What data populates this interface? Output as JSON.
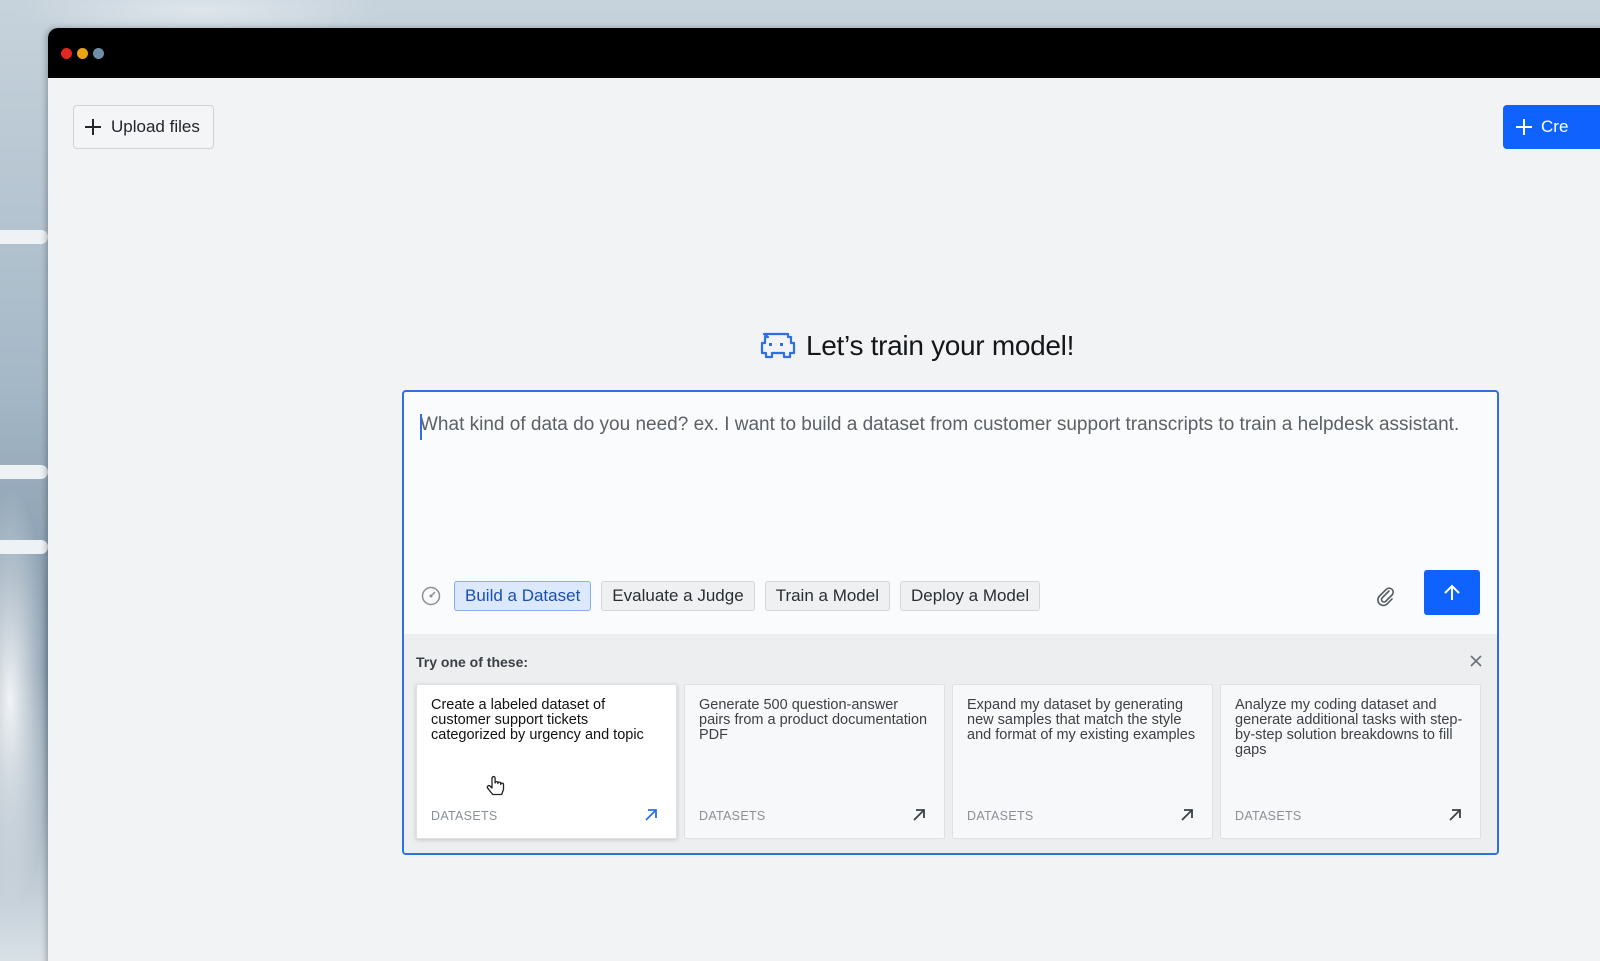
{
  "window": {
    "header": {
      "upload_label": "Upload files",
      "create_label": "Cre"
    },
    "heading": {
      "title": "Let’s train your model!",
      "icon": "robot-mascot-icon"
    },
    "composer": {
      "placeholder": "What kind of data do you need? ex. I want to build a dataset from customer support transcripts to train a helpdesk assistant.",
      "value": "",
      "modes": [
        {
          "label": "Build a Dataset",
          "active": true
        },
        {
          "label": "Evaluate a Judge",
          "active": false
        },
        {
          "label": "Train a Model",
          "active": false
        },
        {
          "label": "Deploy a Model",
          "active": false
        }
      ]
    },
    "suggestions": {
      "title": "Try one of these:",
      "cards": [
        {
          "text": "Create a labeled dataset of customer support tickets categorized by urgency and topic",
          "tag": "DATASETS"
        },
        {
          "text": "Generate 500 question-answer pairs from a product documentation PDF",
          "tag": "DATASETS"
        },
        {
          "text": "Expand my dataset by generating new samples that match the style and format of my existing examples",
          "tag": "DATASETS"
        },
        {
          "text": "Analyze my coding dataset and generate additional tasks with step-by-step solution breakdowns to fill gaps",
          "tag": "DATASETS"
        }
      ]
    }
  },
  "colors": {
    "accent": "#0f62fe",
    "focus_border": "#2f6fe0",
    "active_chip_bg": "#dce8fb"
  }
}
